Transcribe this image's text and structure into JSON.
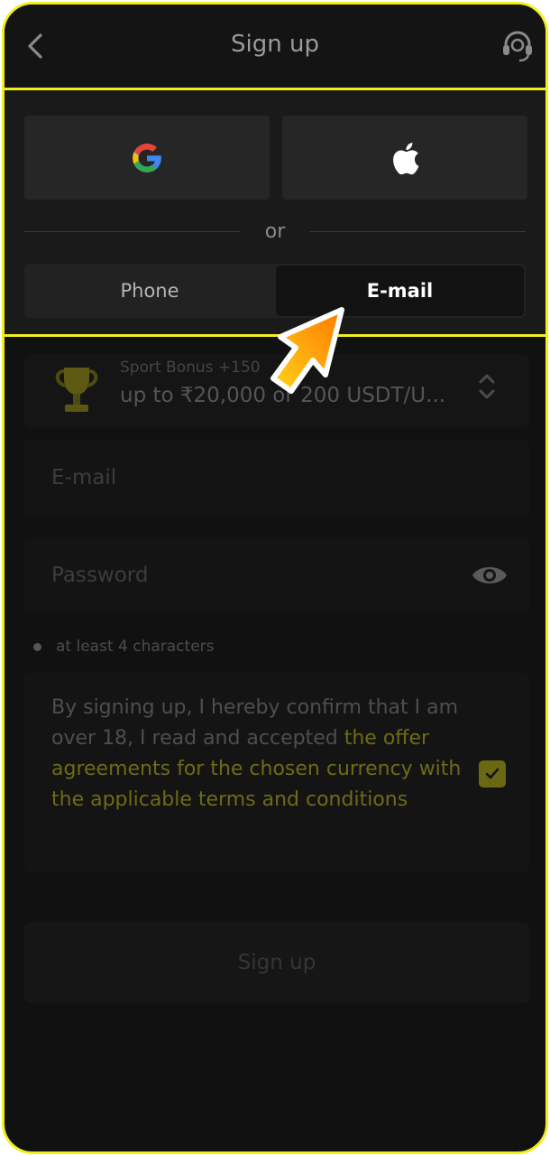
{
  "header": {
    "title": "Sign up",
    "back_icon": "chevron-left-icon",
    "support_icon": "headset-icon"
  },
  "social": {
    "google_icon": "google-logo-icon",
    "apple_icon": "apple-logo-icon",
    "divider_text": "or"
  },
  "tabs": [
    {
      "label": "Phone",
      "active": false
    },
    {
      "label": "E-mail",
      "active": true
    }
  ],
  "bonus": {
    "icon": "trophy-icon",
    "title": "Sport Bonus +150",
    "description": "up to ₹20,000 or 200 USDT/U..."
  },
  "form": {
    "email_placeholder": "E-mail",
    "password_placeholder": "Password",
    "password_hint": "at least 4 characters",
    "eye_icon": "eye-icon"
  },
  "terms": {
    "text": "By signing up, I hereby confirm that I am over 18, I read and accepted ",
    "link": "the offer agreements for the chosen currency with the applicable terms and conditions",
    "checked": true
  },
  "submit_label": "Sign up",
  "colors": {
    "accent": "#f2ef1d",
    "background": "#111111",
    "arrow_start": "#ffd21a",
    "arrow_end": "#ff7a00"
  }
}
